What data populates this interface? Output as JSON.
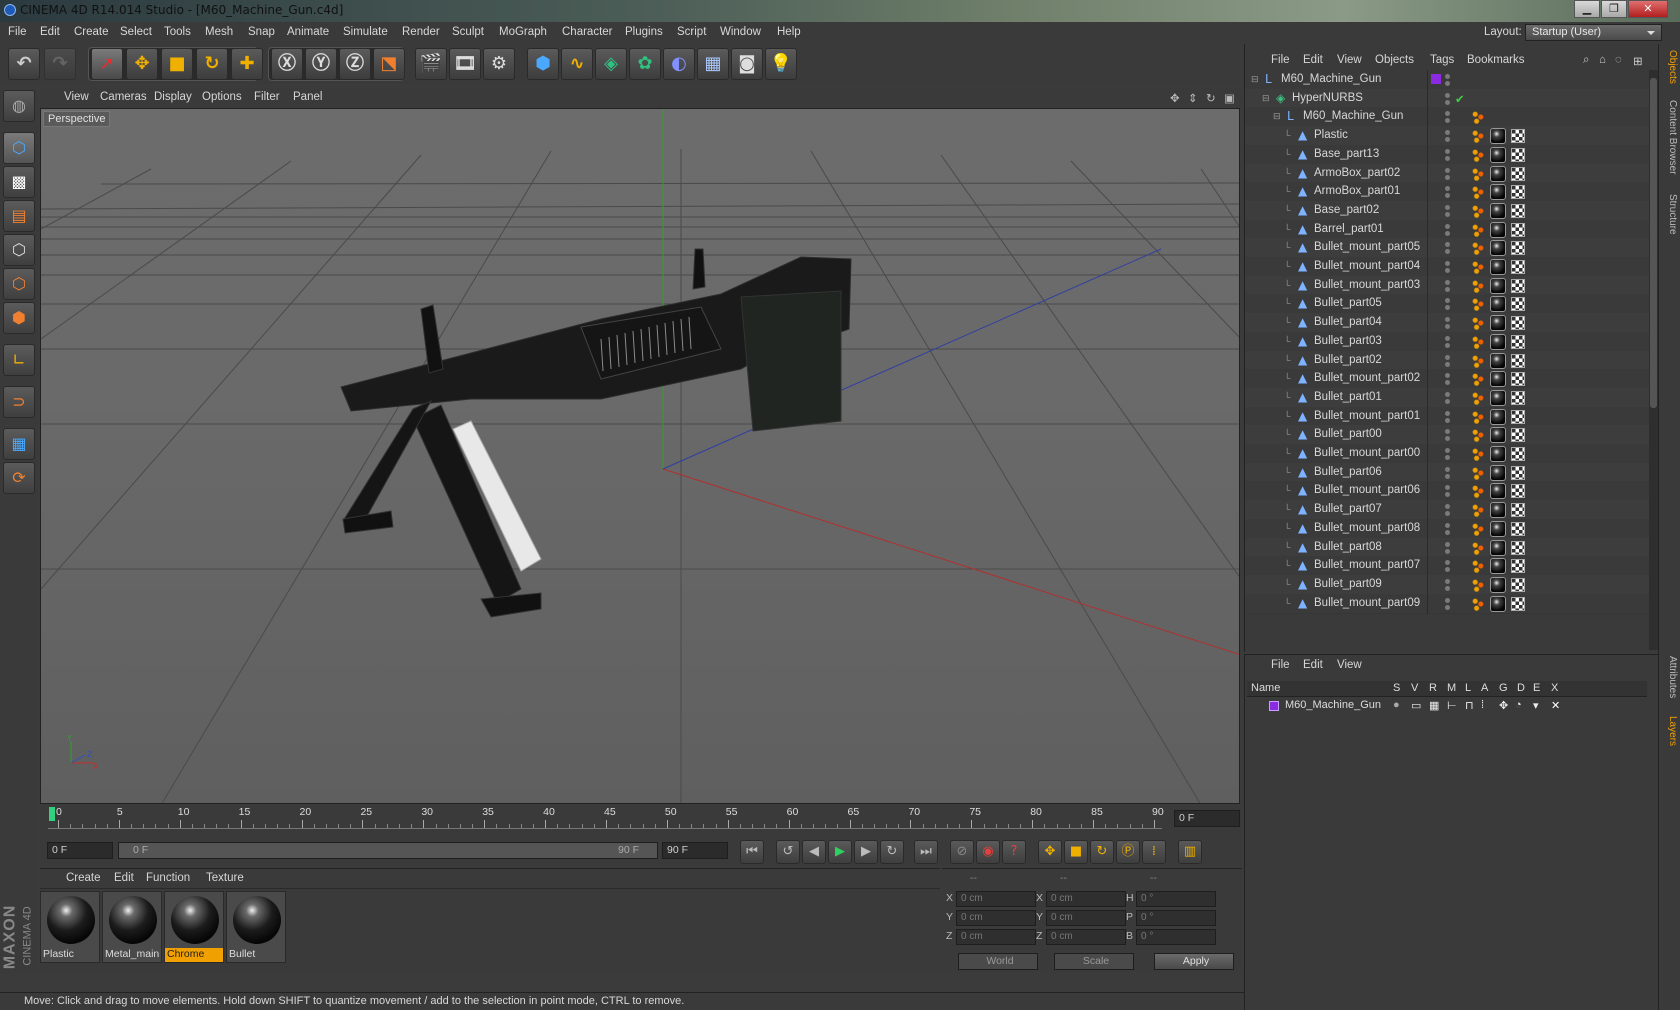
{
  "window": {
    "title": "CINEMA 4D R14.014 Studio - [M60_Machine_Gun.c4d]",
    "min": "▁",
    "max": "❐",
    "close": "✕"
  },
  "menu": [
    "File",
    "Edit",
    "Create",
    "Select",
    "Tools",
    "Mesh",
    "Snap",
    "Animate",
    "Simulate",
    "Render",
    "Sculpt",
    "MoGraph",
    "Character",
    "Plugins",
    "Script",
    "Window",
    "Help"
  ],
  "layout": {
    "label": "Layout:",
    "value": "Startup (User)"
  },
  "viewport": {
    "menu": [
      "View",
      "Cameras",
      "Display",
      "Options",
      "Filter",
      "Panel"
    ],
    "label": "Perspective",
    "axis": {
      "x": "X",
      "y": "Y",
      "z": "Z"
    }
  },
  "timeline": {
    "ticks": [
      "0",
      "5",
      "10",
      "15",
      "20",
      "25",
      "30",
      "35",
      "40",
      "45",
      "50",
      "55",
      "60",
      "65",
      "70",
      "75",
      "80",
      "85",
      "90"
    ],
    "current_frame": "0 F",
    "start": "0 F",
    "range_start": "0 F",
    "range_end": "90 F",
    "end": "90 F"
  },
  "materials": {
    "menu": [
      "Create",
      "Edit",
      "Function",
      "Texture"
    ],
    "items": [
      {
        "name": "Plastic",
        "selected": false
      },
      {
        "name": "Metal_main",
        "selected": false
      },
      {
        "name": "Chrome",
        "selected": true
      },
      {
        "name": "Bullet",
        "selected": false
      }
    ]
  },
  "coords": {
    "header": [
      "--",
      "--",
      "--"
    ],
    "rows": [
      {
        "l1": "X",
        "v1": "0 cm",
        "l2": "X",
        "v2": "0 cm",
        "l3": "H",
        "v3": "0 °"
      },
      {
        "l1": "Y",
        "v1": "0 cm",
        "l2": "Y",
        "v2": "0 cm",
        "l3": "P",
        "v3": "0 °"
      },
      {
        "l1": "Z",
        "v1": "0 cm",
        "l2": "Z",
        "v2": "0 cm",
        "l3": "B",
        "v3": "0 °"
      }
    ],
    "mode1": "World",
    "mode2": "Scale",
    "apply": "Apply"
  },
  "status": "Move: Click and drag to move elements. Hold down SHIFT to quantize movement / add to the selection in point mode, CTRL to remove.",
  "brand": {
    "maxon": "MAXON",
    "c4d": "CINEMA 4D"
  },
  "objects": {
    "menu": [
      "File",
      "Edit",
      "View",
      "Objects",
      "Tags",
      "Bookmarks"
    ],
    "rows": [
      {
        "name": "M60_Machine_Gun",
        "depth": 0,
        "icon": "null-icon",
        "tags": "layer"
      },
      {
        "name": "HyperNURBS",
        "depth": 1,
        "icon": "hypernurbs-icon",
        "tags": "check"
      },
      {
        "name": "M60_Machine_Gun",
        "depth": 2,
        "icon": "null-icon",
        "tags": "phong"
      },
      {
        "name": "Plastic",
        "depth": 3,
        "icon": "poly-icon",
        "tags": "mat"
      },
      {
        "name": "Base_part13",
        "depth": 3,
        "icon": "poly-icon",
        "tags": "mat"
      },
      {
        "name": "ArmoBox_part02",
        "depth": 3,
        "icon": "poly-icon",
        "tags": "mat"
      },
      {
        "name": "ArmoBox_part01",
        "depth": 3,
        "icon": "poly-icon",
        "tags": "mat"
      },
      {
        "name": "Base_part02",
        "depth": 3,
        "icon": "poly-icon",
        "tags": "mat"
      },
      {
        "name": "Barrel_part01",
        "depth": 3,
        "icon": "poly-icon",
        "tags": "mat"
      },
      {
        "name": "Bullet_mount_part05",
        "depth": 3,
        "icon": "poly-icon",
        "tags": "mat"
      },
      {
        "name": "Bullet_mount_part04",
        "depth": 3,
        "icon": "poly-icon",
        "tags": "mat"
      },
      {
        "name": "Bullet_mount_part03",
        "depth": 3,
        "icon": "poly-icon",
        "tags": "mat"
      },
      {
        "name": "Bullet_part05",
        "depth": 3,
        "icon": "poly-icon",
        "tags": "mat"
      },
      {
        "name": "Bullet_part04",
        "depth": 3,
        "icon": "poly-icon",
        "tags": "mat"
      },
      {
        "name": "Bullet_part03",
        "depth": 3,
        "icon": "poly-icon",
        "tags": "mat"
      },
      {
        "name": "Bullet_part02",
        "depth": 3,
        "icon": "poly-icon",
        "tags": "mat"
      },
      {
        "name": "Bullet_mount_part02",
        "depth": 3,
        "icon": "poly-icon",
        "tags": "mat"
      },
      {
        "name": "Bullet_part01",
        "depth": 3,
        "icon": "poly-icon",
        "tags": "mat"
      },
      {
        "name": "Bullet_mount_part01",
        "depth": 3,
        "icon": "poly-icon",
        "tags": "mat"
      },
      {
        "name": "Bullet_part00",
        "depth": 3,
        "icon": "poly-icon",
        "tags": "mat"
      },
      {
        "name": "Bullet_mount_part00",
        "depth": 3,
        "icon": "poly-icon",
        "tags": "mat"
      },
      {
        "name": "Bullet_part06",
        "depth": 3,
        "icon": "poly-icon",
        "tags": "mat"
      },
      {
        "name": "Bullet_mount_part06",
        "depth": 3,
        "icon": "poly-icon",
        "tags": "mat"
      },
      {
        "name": "Bullet_part07",
        "depth": 3,
        "icon": "poly-icon",
        "tags": "mat"
      },
      {
        "name": "Bullet_mount_part08",
        "depth": 3,
        "icon": "poly-icon",
        "tags": "mat"
      },
      {
        "name": "Bullet_part08",
        "depth": 3,
        "icon": "poly-icon",
        "tags": "mat"
      },
      {
        "name": "Bullet_mount_part07",
        "depth": 3,
        "icon": "poly-icon",
        "tags": "mat"
      },
      {
        "name": "Bullet_part09",
        "depth": 3,
        "icon": "poly-icon",
        "tags": "mat"
      },
      {
        "name": "Bullet_mount_part09",
        "depth": 3,
        "icon": "poly-icon",
        "tags": "mat"
      }
    ]
  },
  "layers": {
    "menu": [
      "File",
      "Edit",
      "View"
    ],
    "columns": [
      "Name",
      "S",
      "V",
      "R",
      "M",
      "L",
      "A",
      "G",
      "D",
      "E",
      "X"
    ],
    "rows": [
      {
        "name": "M60_Machine_Gun",
        "color": "#8a2be2"
      }
    ]
  },
  "sidetabs": [
    "Objects",
    "Content Browser",
    "Structure",
    "Attributes",
    "Layers"
  ],
  "colors": {
    "accent": "#f0a000",
    "layer": "#8a2be2",
    "x_axis": "#c03030",
    "y_axis": "#30a030",
    "z_axis": "#3050c0"
  }
}
